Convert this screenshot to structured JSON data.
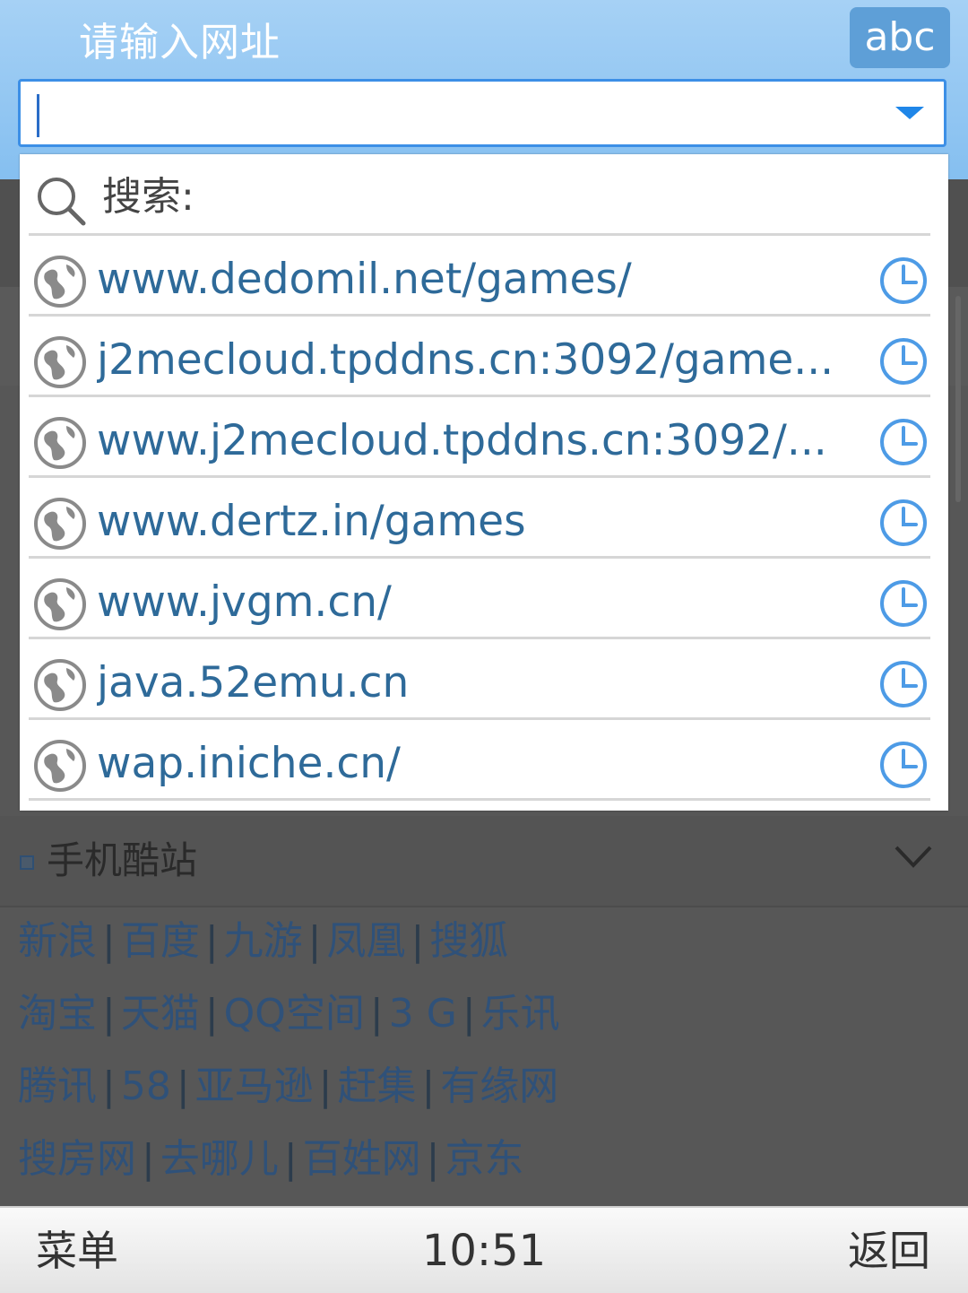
{
  "header": {
    "title": "请输入网址",
    "ime_mode": "abc",
    "url_value": ""
  },
  "suggestions": {
    "search_label": "搜索:",
    "items": [
      "www.dedomil.net/games/",
      "j2mecloud.tpddns.cn:3092/game...",
      "www.j2mecloud.tpddns.cn:3092/...",
      "www.dertz.in/games",
      "www.jvgm.cn/",
      "java.52emu.cn",
      "wap.iniche.cn/"
    ]
  },
  "page": {
    "section_title": "手机酷站",
    "links": [
      [
        "新浪",
        "百度",
        "九游",
        "凤凰",
        "搜狐"
      ],
      [
        "淘宝",
        "天猫",
        "QQ空间",
        "3 G",
        "乐讯"
      ],
      [
        "腾讯",
        "58",
        "亚马逊",
        "赶集",
        "有缘网"
      ],
      [
        "搜房网",
        "去哪儿",
        "百姓网",
        "京东"
      ]
    ]
  },
  "softkeys": {
    "left": "菜单",
    "time": "10:51",
    "right": "返回"
  },
  "colors": {
    "accent": "#3c8fe6",
    "suggestion_text": "#2e6a99",
    "header_top": "#a6d1f5"
  }
}
